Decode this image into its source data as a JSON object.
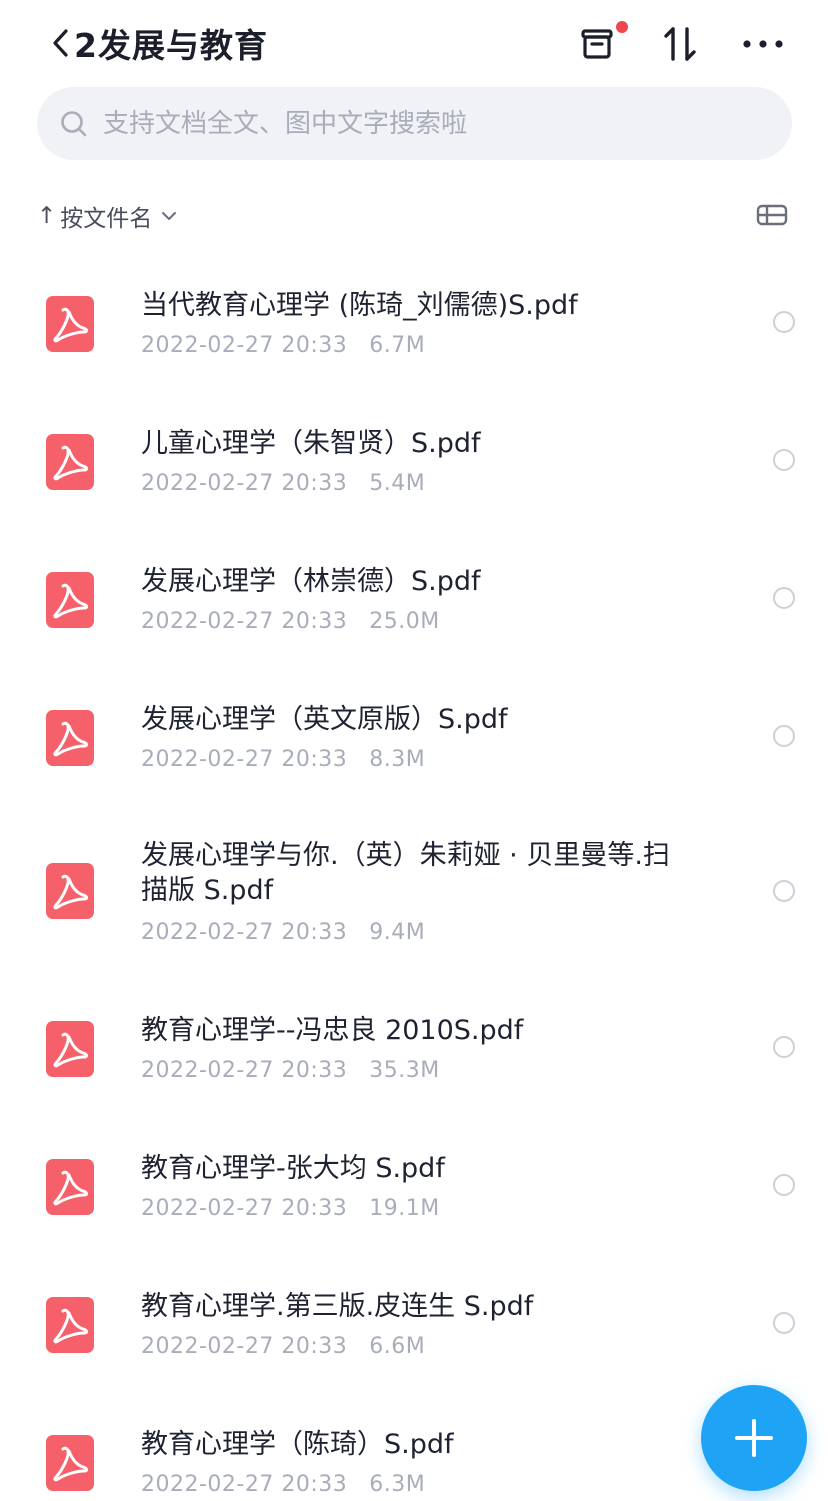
{
  "header": {
    "title": "2发展与教育",
    "icons": [
      "back-icon",
      "recycle-bin-icon",
      "sort-icon",
      "more-icon"
    ]
  },
  "colors": {
    "accent": "#1ea3f5",
    "pdf_icon": "#f6606a",
    "badge": "#f0464d",
    "meta_text": "#a9adba"
  },
  "search": {
    "placeholder": "支持文档全文、图中文字搜索啦"
  },
  "sort": {
    "arrow": "↑",
    "label": "按文件名"
  },
  "files": [
    {
      "name": "当代教育心理学 (陈琦_刘儒德)S.pdf",
      "date": "2022-02-27 20:33",
      "size": "6.7M"
    },
    {
      "name": "儿童心理学（朱智贤）S.pdf",
      "date": "2022-02-27 20:33",
      "size": "5.4M"
    },
    {
      "name": "发展心理学（林崇德）S.pdf",
      "date": "2022-02-27 20:33",
      "size": "25.0M"
    },
    {
      "name": "发展心理学（英文原版）S.pdf",
      "date": "2022-02-27 20:33",
      "size": "8.3M"
    },
    {
      "name": "发展心理学与你.（英）朱莉娅 · 贝里曼等.扫描版 S.pdf",
      "date": "2022-02-27 20:33",
      "size": "9.4M"
    },
    {
      "name": "教育心理学--冯忠良 2010S.pdf",
      "date": "2022-02-27 20:33",
      "size": "35.3M"
    },
    {
      "name": "教育心理学-张大均 S.pdf",
      "date": "2022-02-27 20:33",
      "size": "19.1M"
    },
    {
      "name": "教育心理学.第三版.皮连生 S.pdf",
      "date": "2022-02-27 20:33",
      "size": "6.6M"
    },
    {
      "name": "教育心理学（陈琦）S.pdf",
      "date": "2022-02-27 20:33",
      "size": "6.3M"
    }
  ]
}
